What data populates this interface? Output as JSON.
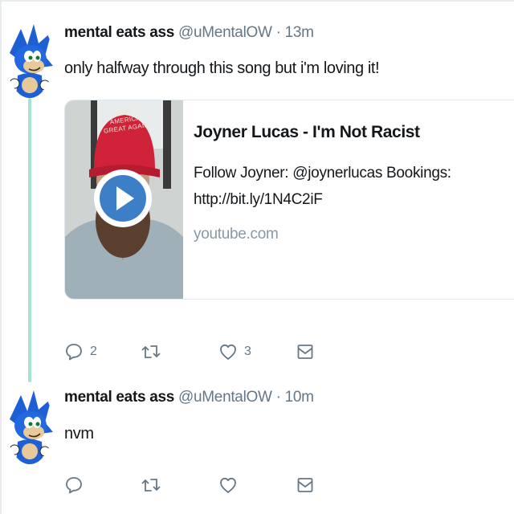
{
  "tweets": [
    {
      "name": "mental eats ass",
      "handle": "@uMentalOW",
      "separator": "·",
      "time": "13m",
      "text": "only halfway through this song but i'm loving it!",
      "card": {
        "title": "Joyner Lucas - I'm Not Racist",
        "description": "Follow Joyner: @joynerlucas Bookings: http://bit.ly/1N4C2iF",
        "domain": "youtube.com",
        "hat_text": "MAKE AMERICA GREAT AGAIN"
      },
      "actions": {
        "reply_count": "2",
        "retweet_count": "",
        "like_count": "3"
      }
    },
    {
      "name": "mental eats ass",
      "handle": "@uMentalOW",
      "separator": "·",
      "time": "10m",
      "text": "nvm",
      "actions": {
        "reply_count": "",
        "retweet_count": "",
        "like_count": ""
      }
    }
  ],
  "icons": {
    "reply": "reply-icon",
    "retweet": "retweet-icon",
    "like": "heart-icon",
    "dm": "envelope-icon",
    "play": "play-icon"
  },
  "colors": {
    "thread_line": "#a3e3d4",
    "muted": "#657786",
    "domain": "#8899a6",
    "play_blue": "#3d7fc6",
    "avatar_blue": "#1f5fd4"
  }
}
